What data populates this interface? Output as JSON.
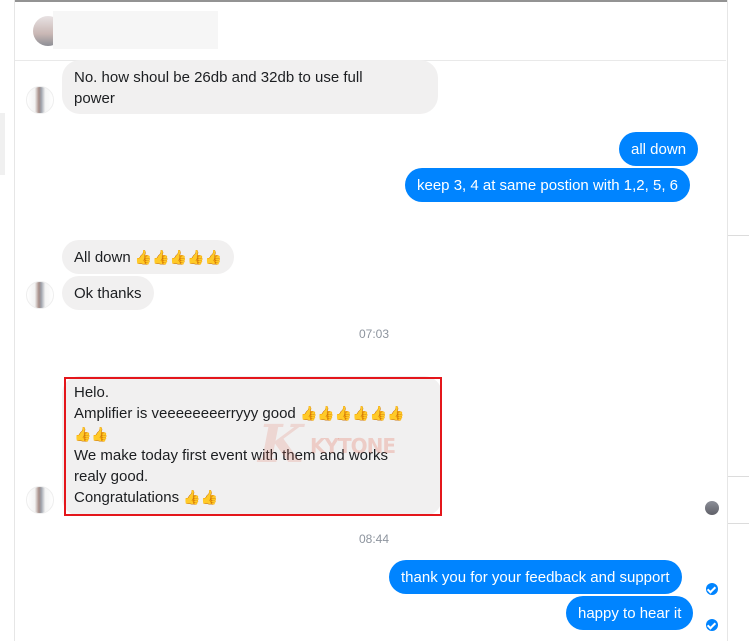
{
  "conversation": {
    "messages": [
      {
        "from": "contact",
        "lines": [
          "No. how shoul be 26db and 32db to use full",
          "power"
        ]
      },
      {
        "from": "me",
        "text": "all down"
      },
      {
        "from": "me",
        "text": "keep 3, 4 at same postion with 1,2, 5, 6"
      },
      {
        "from": "contact",
        "text": "All down",
        "emoji": "👍👍👍👍👍"
      },
      {
        "from": "contact",
        "text": "Ok thanks"
      },
      {
        "from": "contact",
        "lines": [
          "Helo.",
          "Amplifier is veeeeeeeerryyy good",
          "",
          "We make today first event with them and works",
          "realy good.",
          "Congratulations"
        ],
        "emoji_line2": "👍👍👍👍👍👍",
        "emoji_line3": "👍👍",
        "emoji_line6": "👍👍"
      },
      {
        "from": "me",
        "text": "thank you for your feedback and support"
      },
      {
        "from": "me",
        "text": "happy to hear it"
      }
    ],
    "timestamps": [
      "07:03",
      "08:44"
    ]
  },
  "watermark": {
    "text": "KYTONE"
  },
  "colors": {
    "outgoing": "#0084ff",
    "incoming": "#f1f0f0",
    "highlight": "#e4161b",
    "timestamp": "#8d949e"
  }
}
